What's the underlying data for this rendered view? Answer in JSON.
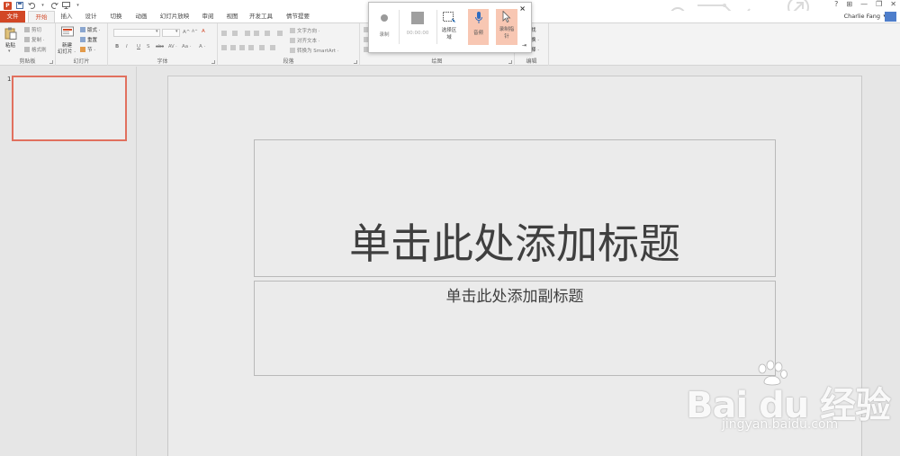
{
  "window": {
    "controls": [
      "?",
      "⊞",
      "—",
      "❐",
      "✕"
    ]
  },
  "quick_access": {
    "app_icon": "P",
    "icons": [
      "save-icon",
      "undo-icon",
      "redo-icon",
      "start-from-beginning-icon",
      "customize-icon"
    ]
  },
  "tabs": [
    {
      "label": "文件"
    },
    {
      "label": "开始"
    },
    {
      "label": "插入"
    },
    {
      "label": "设计"
    },
    {
      "label": "切换"
    },
    {
      "label": "动画"
    },
    {
      "label": "幻灯片放映"
    },
    {
      "label": "审阅"
    },
    {
      "label": "视图"
    },
    {
      "label": "开发工具"
    },
    {
      "label": "情节提要"
    }
  ],
  "account": {
    "user_name": "Charlie Fang"
  },
  "ribbon": {
    "clipboard": {
      "group_label": "剪贴板",
      "paste": "粘贴",
      "cut": "剪切",
      "copy": "复制 ·",
      "format_painter": "格式刷"
    },
    "slides": {
      "group_label": "幻灯片",
      "new_slide_line1": "新建",
      "new_slide_line2": "幻灯片 ·",
      "layout": "版式 ·",
      "reset": "重置",
      "section": "节 ·"
    },
    "font": {
      "group_label": "字体",
      "bold": "B",
      "italic": "I",
      "underline": "U",
      "shadow": "S",
      "strike": "abc",
      "spacing": "AV ·",
      "case": "Aa ·",
      "grow": "A^",
      "shrink": "A^",
      "clear": "A",
      "color": "A ·"
    },
    "paragraph": {
      "group_label": "段落",
      "text_direction": "文字方向 ·",
      "align_text": "对齐文本 ·",
      "convert_smartart": "转换为 SmartArt ·"
    },
    "drawing": {
      "group_label": "绘图"
    },
    "editing": {
      "group_label": "编辑",
      "find": "找",
      "replace": "换 ·",
      "select": "择 ·"
    }
  },
  "recording_popup": {
    "record": "录制",
    "time": "00:00:00",
    "select_area_line1": "选择区",
    "select_area_line2": "域",
    "audio": "音频",
    "record_pointer_line1": "录制指",
    "record_pointer_line2": "针",
    "close": "×",
    "pin": "⇥"
  },
  "slide_panel": {
    "slide_number": "1"
  },
  "slide": {
    "title_placeholder": "单击此处添加标题",
    "subtitle_placeholder": "单击此处添加副标题"
  },
  "watermark": {
    "logo_text": "Bai  du 经验",
    "url": "jingyan.baidu.com"
  },
  "colors": {
    "accent": "#d24726",
    "thumb_border": "#e1705e",
    "highlight": "#f8c7b3"
  }
}
